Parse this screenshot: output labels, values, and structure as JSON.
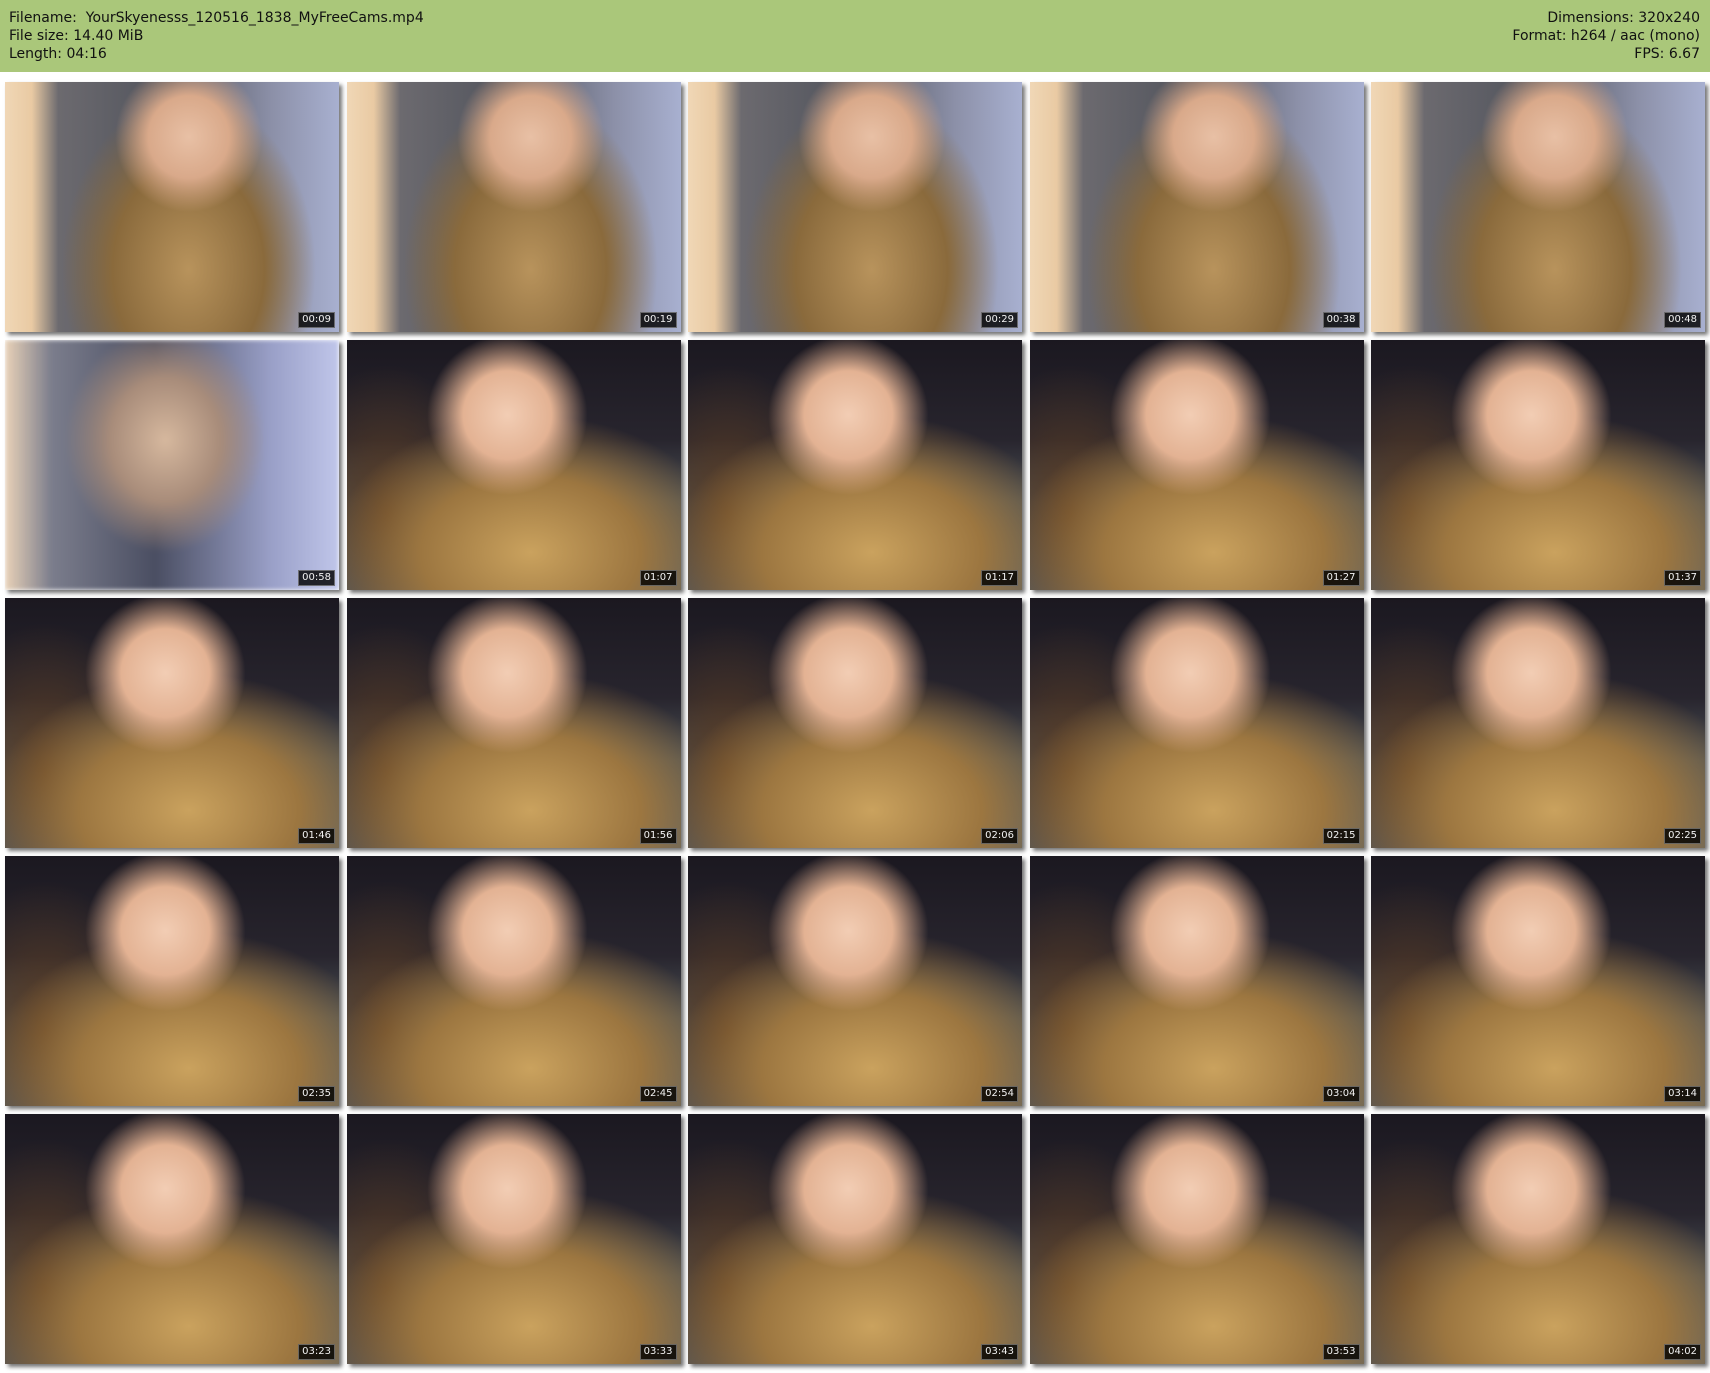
{
  "header": {
    "filename_label": "Filename:",
    "filename": "YourSkyenesss_120516_1838_MyFreeCams.mp4",
    "filesize_label": "File size:",
    "filesize": "14.40 MiB",
    "length_label": "Length:",
    "length": "04:16",
    "dimensions_label": "Dimensions:",
    "dimensions": "320x240",
    "format_label": "Format:",
    "format": "h264 / aac (mono)",
    "fps_label": "FPS:",
    "fps": "6.67",
    "background_color": "#aac77a"
  },
  "thumbnails": [
    {
      "time": "00:09",
      "scene": "couch"
    },
    {
      "time": "00:19",
      "scene": "couch"
    },
    {
      "time": "00:29",
      "scene": "couch"
    },
    {
      "time": "00:38",
      "scene": "couch"
    },
    {
      "time": "00:48",
      "scene": "couch"
    },
    {
      "time": "00:58",
      "scene": "blur"
    },
    {
      "time": "01:07",
      "scene": "closeup"
    },
    {
      "time": "01:17",
      "scene": "closeup"
    },
    {
      "time": "01:27",
      "scene": "closeup"
    },
    {
      "time": "01:37",
      "scene": "closeup"
    },
    {
      "time": "01:46",
      "scene": "closeup"
    },
    {
      "time": "01:56",
      "scene": "closeup"
    },
    {
      "time": "02:06",
      "scene": "closeup"
    },
    {
      "time": "02:15",
      "scene": "closeup"
    },
    {
      "time": "02:25",
      "scene": "closeup"
    },
    {
      "time": "02:35",
      "scene": "closeup"
    },
    {
      "time": "02:45",
      "scene": "closeup"
    },
    {
      "time": "02:54",
      "scene": "closeup"
    },
    {
      "time": "03:04",
      "scene": "closeup"
    },
    {
      "time": "03:14",
      "scene": "closeup"
    },
    {
      "time": "03:23",
      "scene": "closeup"
    },
    {
      "time": "03:33",
      "scene": "closeup"
    },
    {
      "time": "03:43",
      "scene": "closeup"
    },
    {
      "time": "03:53",
      "scene": "closeup"
    },
    {
      "time": "04:02",
      "scene": "closeup"
    }
  ]
}
